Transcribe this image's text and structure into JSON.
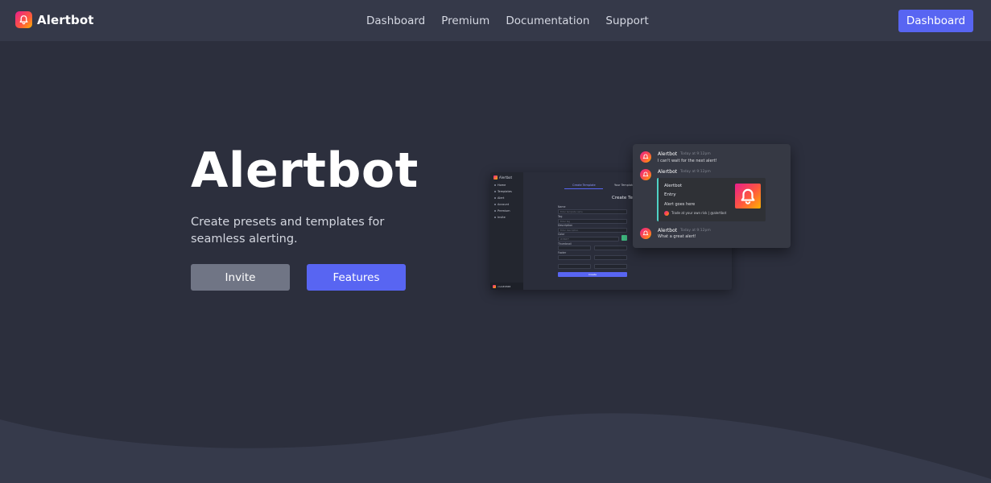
{
  "navbar": {
    "brand": "Alertbot",
    "links": [
      "Dashboard",
      "Premium",
      "Documentation",
      "Support"
    ],
    "cta": "Dashboard"
  },
  "hero": {
    "title": "Alertbot",
    "subtitle": "Create presets and templates for seamless alerting.",
    "invite_label": "Invite",
    "features_label": "Features"
  },
  "mock": {
    "brand": "Alertbot",
    "side_items": [
      "Home",
      "Templates",
      "Alert",
      "Account",
      "Premium",
      "Invite"
    ],
    "user": "cool#4848",
    "tabs": [
      "Create Template",
      "Your Templates"
    ],
    "title": "Create Tem",
    "labels": [
      "Name",
      "Tag",
      "Description",
      "Color",
      "Thumbnail",
      "Footer"
    ],
    "placeholders": [
      "Enter template name",
      "Enter tag",
      "Enter description",
      "#3fb87f"
    ],
    "create": "Create"
  },
  "chat": {
    "name": "Alertbot",
    "time": "Today at 9:12pm",
    "msg1": "I can't wait for the next alert!",
    "embed": {
      "title": "Alertbot",
      "heading": "Entry",
      "body": "Alert goes here",
      "footer": "Trade at your own risk | @alertbot"
    },
    "msg3": "What a great alert!"
  },
  "colors": {
    "accent": "#5865f2",
    "background": "#2c2f3d",
    "navbar": "#353949",
    "secondary_button": "#707585"
  }
}
